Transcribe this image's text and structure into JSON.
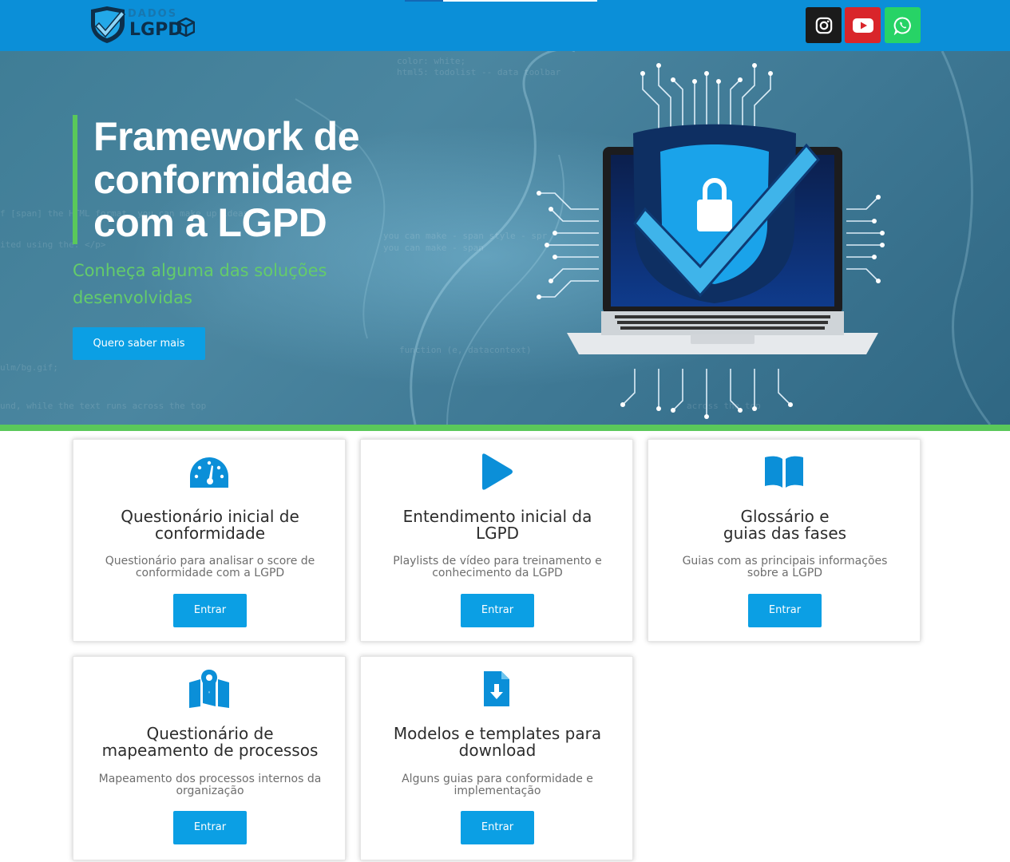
{
  "header": {
    "logo_top": "DADOS",
    "logo_main": "LGPD",
    "social": [
      {
        "name": "Instagram",
        "icon": "instagram-icon",
        "color": "#1b1b1b"
      },
      {
        "name": "YouTube",
        "icon": "youtube-icon",
        "color": "#d9252a"
      },
      {
        "name": "WhatsApp",
        "icon": "whatsapp-icon",
        "color": "#27d366"
      }
    ],
    "bar_color": "#0b8fd8",
    "scroll_progress": 0.2
  },
  "hero": {
    "title_lines": [
      "Framework de",
      "conformidade",
      "com a LGPD"
    ],
    "subtitle_lines": [
      "Conheça alguma das soluções",
      "desenvolvidas"
    ],
    "button_label": "Quero saber mais",
    "accent_color": "#5ac85a"
  },
  "cards": [
    {
      "icon": "speedometer-icon",
      "title": "Questionário inicial de conformidade",
      "title_lines": [
        "Questionário inicial de",
        "conformidade"
      ],
      "desc_lines": [
        "Questionário para analisar o score de",
        "conformidade com a LGPD"
      ],
      "button": "Entrar"
    },
    {
      "icon": "play-icon",
      "title": "Entendimento inicial da LGPD",
      "title_lines": [
        "Entendimento inicial da",
        "LGPD"
      ],
      "desc_lines": [
        "Playlists de vídeo para treinamento e",
        "conhecimento da LGPD"
      ],
      "button": "Entrar"
    },
    {
      "icon": "book-open-icon",
      "title": "Glossário e guias das fases",
      "title_lines": [
        "Glossário e",
        "guias das fases"
      ],
      "desc_lines": [
        "Guias com as principais informações",
        "sobre a LGPD"
      ],
      "button": "Entrar"
    },
    {
      "icon": "map-pin-icon",
      "title": "Questionário de mapeamento de processos",
      "title_lines": [
        "Questionário de",
        "mapeamento de processos"
      ],
      "desc_lines": [
        "Mapeamento dos processos internos da",
        "organização"
      ],
      "button": "Entrar"
    },
    {
      "icon": "file-download-icon",
      "title": "Modelos e templates para download",
      "title_lines": [
        "Modelos e templates para",
        "download"
      ],
      "desc_lines": [
        "Alguns guias para conformidade e",
        "implementação"
      ],
      "button": "Entrar"
    }
  ]
}
